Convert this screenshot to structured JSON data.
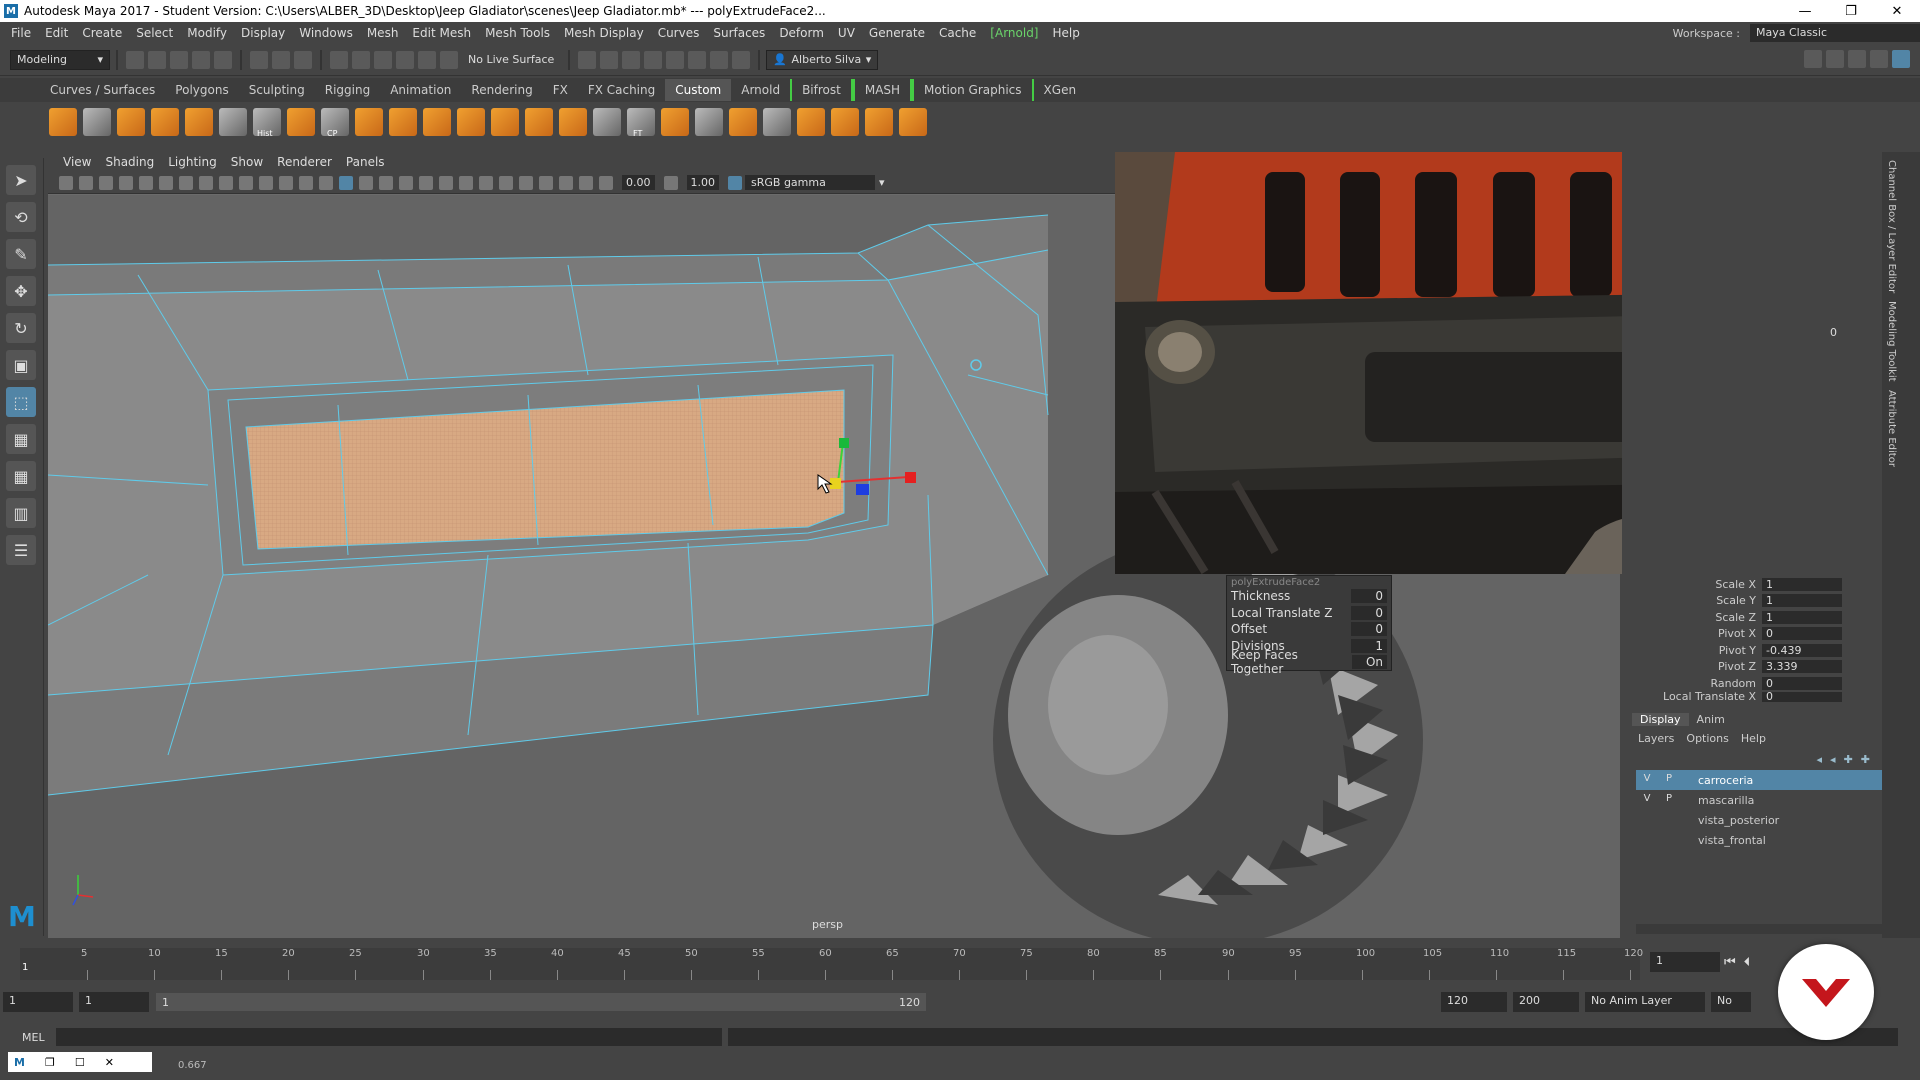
{
  "window": {
    "title": "Autodesk Maya 2017 - Student Version: C:\\Users\\ALBER_3D\\Desktop\\Jeep Gladiator\\scenes\\Jeep Gladiator.mb*  ---  polyExtrudeFace2...",
    "logo": "M"
  },
  "menubar": {
    "items": [
      "File",
      "Edit",
      "Create",
      "Select",
      "Modify",
      "Display",
      "Windows",
      "Mesh",
      "Edit Mesh",
      "Mesh Tools",
      "Mesh Display",
      "Curves",
      "Surfaces",
      "Deform",
      "UV",
      "Generate",
      "Cache",
      "[Arnold]",
      "Help"
    ],
    "workspace_label": "Workspace :",
    "workspace_value": "Maya Classic"
  },
  "statusline": {
    "mode": "Modeling",
    "live_surface": "No Live Surface",
    "user": "Alberto Silva"
  },
  "shelf": {
    "tabs": [
      "Curves / Surfaces",
      "Polygons",
      "Sculpting",
      "Rigging",
      "Animation",
      "Rendering",
      "FX",
      "FX Caching",
      "Custom",
      "Arnold",
      "Bifrost",
      "MASH",
      "Motion Graphics",
      "XGen"
    ],
    "active_tab": "Custom",
    "icon_labels": [
      "Hist",
      "CP",
      "FT"
    ]
  },
  "viewport": {
    "menu": [
      "View",
      "Shading",
      "Lighting",
      "Show",
      "Renderer",
      "Panels"
    ],
    "near_value": "0.00",
    "far_value": "1.00",
    "color_space": "sRGB gamma",
    "camera_label": "persp"
  },
  "polyextrude": {
    "header": "polyExtrudeFace2",
    "rows": [
      {
        "name": "Thickness",
        "value": "0"
      },
      {
        "name": "Local Translate Z",
        "value": "0"
      },
      {
        "name": "Offset",
        "value": "0"
      },
      {
        "name": "Divisions",
        "value": "1"
      },
      {
        "name": "Keep Faces Together",
        "value": "On"
      }
    ]
  },
  "channelbox": {
    "top_value": "0",
    "rows": [
      {
        "name": "Scale X",
        "value": "1"
      },
      {
        "name": "Scale Y",
        "value": "1"
      },
      {
        "name": "Scale Z",
        "value": "1"
      },
      {
        "name": "Pivot X",
        "value": "0"
      },
      {
        "name": "Pivot Y",
        "value": "-0.439"
      },
      {
        "name": "Pivot Z",
        "value": "3.339"
      },
      {
        "name": "Random",
        "value": "0"
      },
      {
        "name": "Local Translate X",
        "value": "0"
      }
    ],
    "side_tabs": [
      "Channel Box / Layer Editor",
      "Modeling Toolkit",
      "Attribute Editor"
    ]
  },
  "layers": {
    "tabs": [
      "Display",
      "Anim"
    ],
    "menu": [
      "Layers",
      "Options",
      "Help"
    ],
    "items": [
      {
        "v": "V",
        "p": "P",
        "name": "carroceria",
        "selected": true
      },
      {
        "v": "V",
        "p": "P",
        "name": "mascarilla",
        "selected": false
      },
      {
        "v": "",
        "p": "",
        "name": "vista_posterior",
        "selected": false
      },
      {
        "v": "",
        "p": "",
        "name": "vista_frontal",
        "selected": false
      }
    ]
  },
  "timeline": {
    "ticks": [
      "5",
      "10",
      "15",
      "20",
      "25",
      "30",
      "35",
      "40",
      "45",
      "50",
      "55",
      "60",
      "65",
      "70",
      "75",
      "80",
      "85",
      "90",
      "95",
      "100",
      "105",
      "110",
      "115",
      "120"
    ],
    "current_marker": "1",
    "current_frame": "1"
  },
  "range": {
    "start": "1",
    "playback_start": "1",
    "slider_start": "1",
    "slider_end": "120",
    "playback_end": "120",
    "end": "200",
    "anim_layer": "No Anim Layer",
    "char_set": "No"
  },
  "cmdline": {
    "label": "MEL"
  },
  "helpline": {
    "value": "0.667"
  },
  "colors": {
    "accent": "#5285a6",
    "wire": "#5fcbea",
    "face_selected": "#d9a97f",
    "badge": "#c4161c"
  }
}
